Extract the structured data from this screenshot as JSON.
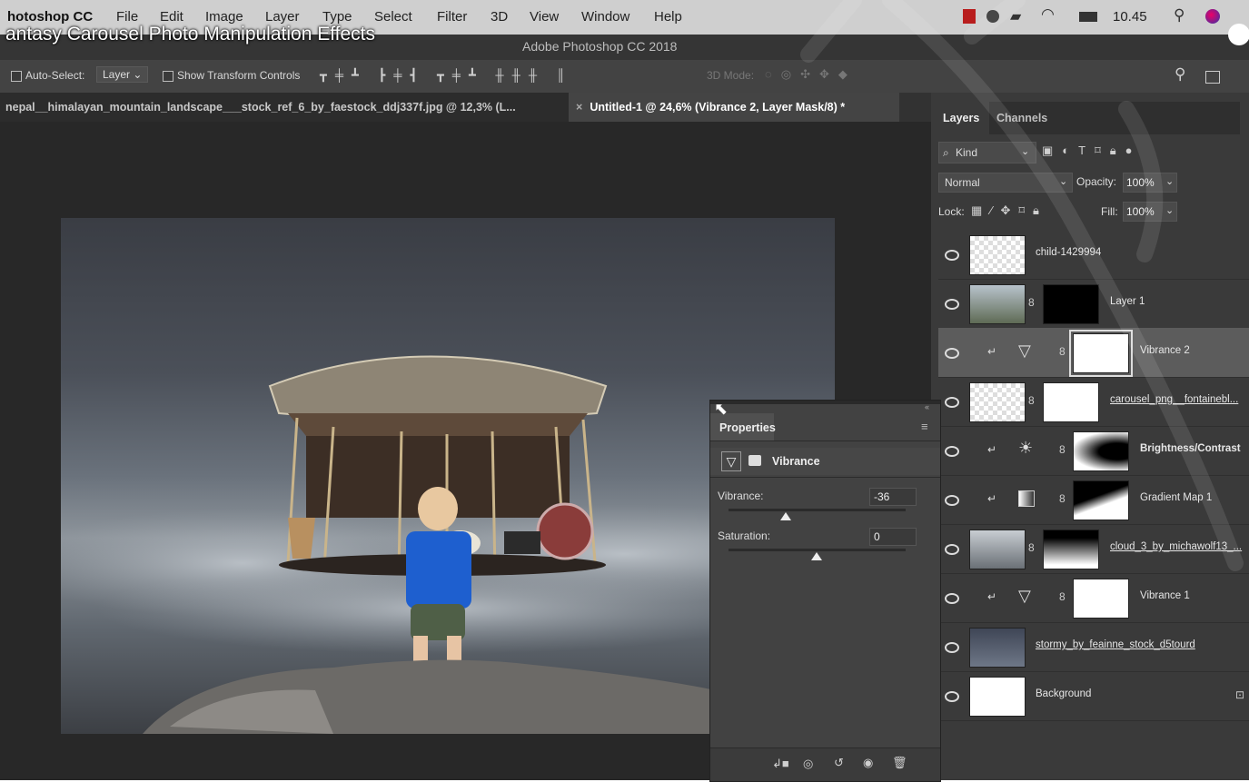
{
  "video_title": "antasy Carousel Photo Manipulation Effects",
  "menubar": {
    "app_name": "hotoshop CC",
    "items": [
      "File",
      "Edit",
      "Image",
      "Layer",
      "Type",
      "Select",
      "Filter",
      "3D",
      "View",
      "Window",
      "Help"
    ],
    "clock": "10.45"
  },
  "window_title": "Adobe Photoshop CC 2018",
  "options_bar": {
    "auto_select_label": "Auto-Select:",
    "auto_select_value": "Layer",
    "show_transform_label": "Show Transform Controls",
    "mode_3d_label": "3D Mode:"
  },
  "doc_tabs": [
    {
      "label": "nepal__himalayan_mountain_landscape___stock_ref_6_by_faestock_ddj337f.jpg @ 12,3% (L...",
      "active": false
    },
    {
      "label": "Untitled-1 @ 24,6% (Vibrance 2, Layer Mask/8) *",
      "active": true
    }
  ],
  "layers_panel": {
    "tabs": [
      "Layers",
      "Channels"
    ],
    "filter_label": "Kind",
    "blend_mode": "Normal",
    "opacity_label": "Opacity:",
    "opacity_value": "100%",
    "lock_label": "Lock:",
    "fill_label": "Fill:",
    "fill_value": "100%",
    "layers": [
      {
        "name": "child-1429994"
      },
      {
        "name": "Layer 1"
      },
      {
        "name": "Vibrance 2"
      },
      {
        "name": "carousel_png__fontainebl..."
      },
      {
        "name": "Brightness/Contrast"
      },
      {
        "name": "Gradient Map 1"
      },
      {
        "name": "cloud_3_by_michawolf13_..."
      },
      {
        "name": "Vibrance 1"
      },
      {
        "name": "stormy_by_feainne_stock_d5tourd"
      },
      {
        "name": "Background"
      }
    ]
  },
  "properties_panel": {
    "title": "Properties",
    "adjustment_name": "Vibrance",
    "vibrance_label": "Vibrance:",
    "vibrance_value": "-36",
    "saturation_label": "Saturation:",
    "saturation_value": "0",
    "vibrance_level": -36,
    "saturation_level": 0
  },
  "colors": {
    "menubar": "#cfcfcf",
    "panel": "#3a3a3a",
    "workspace": "#282828",
    "selected_layer": "#5c5c5c"
  }
}
